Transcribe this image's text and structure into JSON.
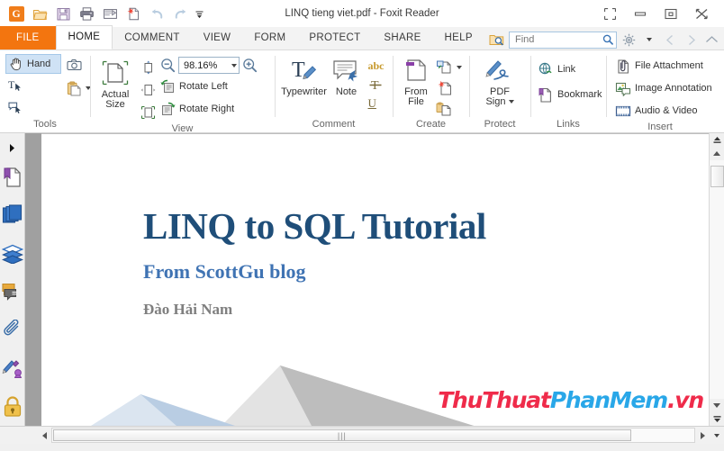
{
  "window": {
    "title": "LINQ tieng viet.pdf - Foxit Reader",
    "controls": {
      "restore_layout": "⛶",
      "minimize": "—",
      "maximize": "❐",
      "close": "✕"
    }
  },
  "quick_access": {
    "items": [
      {
        "name": "foxit-logo-icon",
        "label": "G"
      },
      {
        "name": "open-icon",
        "label": "Open"
      },
      {
        "name": "save-icon",
        "label": "Save"
      },
      {
        "name": "print-icon",
        "label": "Print"
      },
      {
        "name": "email-icon",
        "label": "Email"
      },
      {
        "name": "new-from-file-icon",
        "label": "New"
      },
      {
        "name": "undo-icon",
        "label": "Undo"
      },
      {
        "name": "redo-icon",
        "label": "Redo"
      },
      {
        "name": "qat-dropdown-icon",
        "label": "More"
      }
    ]
  },
  "tabs": [
    {
      "label": "FILE",
      "active": false,
      "file": true
    },
    {
      "label": "HOME",
      "active": true,
      "file": false
    },
    {
      "label": "COMMENT",
      "active": false,
      "file": false
    },
    {
      "label": "VIEW",
      "active": false,
      "file": false
    },
    {
      "label": "FORM",
      "active": false,
      "file": false
    },
    {
      "label": "PROTECT",
      "active": false,
      "file": false
    },
    {
      "label": "SHARE",
      "active": false,
      "file": false
    },
    {
      "label": "HELP",
      "active": false,
      "file": false
    }
  ],
  "search": {
    "placeholder": "Find",
    "value": "",
    "icon": "search-icon",
    "settings_icon": "gear-icon"
  },
  "ribbon": {
    "groups": [
      {
        "label": "Tools",
        "buttons": [
          {
            "label": "Hand",
            "icon": "hand-icon",
            "selected": true
          },
          {
            "label": "Select Text",
            "icon": "select-text-icon",
            "selected": false
          },
          {
            "label": "Select Annotation",
            "icon": "select-annotation-icon",
            "selected": false
          },
          {
            "label": "Snapshot",
            "icon": "camera-icon",
            "selected": false
          },
          {
            "label": "Clipboard",
            "icon": "clipboard-icon",
            "selected": false
          }
        ]
      },
      {
        "label": "View",
        "buttons": [
          {
            "label": "Actual Size",
            "icon": "actual-size-icon"
          },
          {
            "label": "Fit Page",
            "icon": "fit-page-icon"
          },
          {
            "label": "Fit Width",
            "icon": "fit-width-icon"
          },
          {
            "label": "Fit Visible",
            "icon": "fit-visible-icon"
          },
          {
            "label": "Zoom Out",
            "icon": "zoom-out-icon"
          },
          {
            "label": "Zoom In",
            "icon": "zoom-in-icon"
          },
          {
            "label": "Rotate Left",
            "icon": "rotate-left-icon"
          },
          {
            "label": "Rotate Right",
            "icon": "rotate-right-icon"
          }
        ],
        "zoom_value": "98.16%"
      },
      {
        "label": "Comment",
        "buttons": [
          {
            "label": "Typewriter",
            "icon": "typewriter-icon"
          },
          {
            "label": "Note",
            "icon": "note-icon"
          },
          {
            "label": "Highlight",
            "icon": "abc-highlight-icon"
          },
          {
            "label": "Strikeout",
            "icon": "strikeout-icon"
          },
          {
            "label": "Underline",
            "icon": "underline-icon"
          }
        ]
      },
      {
        "label": "Create",
        "buttons": [
          {
            "label": "From File",
            "icon": "from-file-icon"
          },
          {
            "label": "From Scanner",
            "icon": "from-scanner-icon"
          },
          {
            "label": "Blank",
            "icon": "blank-page-icon"
          },
          {
            "label": "From Clipboard",
            "icon": "from-clipboard-icon"
          }
        ]
      },
      {
        "label": "Protect",
        "buttons": [
          {
            "label": "PDF Sign",
            "icon": "pdf-sign-icon"
          }
        ]
      },
      {
        "label": "Links",
        "buttons": [
          {
            "label": "Link",
            "icon": "link-icon"
          },
          {
            "label": "Bookmark",
            "icon": "bookmark-icon"
          }
        ]
      },
      {
        "label": "Insert",
        "buttons": [
          {
            "label": "File Attachment",
            "icon": "file-attachment-icon"
          },
          {
            "label": "Image Annotation",
            "icon": "image-annotation-icon"
          },
          {
            "label": "Audio & Video",
            "icon": "audio-video-icon"
          }
        ]
      }
    ],
    "labels": {
      "hand": "Hand",
      "actual_size": "Actual Size",
      "rotate_left": "Rotate Left",
      "rotate_right": "Rotate Right",
      "typewriter": "Typewriter",
      "note": "Note",
      "from_file": "From File",
      "pdf_sign": "PDF Sign",
      "link": "Link",
      "bookmark": "Bookmark",
      "file_attachment": "File Attachment",
      "image_annotation": "Image Annotation",
      "audio_video": "Audio & Video",
      "abc": "abc",
      "underline": "U"
    }
  },
  "sidebar": {
    "items": [
      {
        "name": "sidebar-expand-toggle",
        "label": "Expand Panel"
      },
      {
        "name": "sidebar-item-bookmarks",
        "label": "Bookmarks"
      },
      {
        "name": "sidebar-item-pages",
        "label": "Page Thumbnails"
      },
      {
        "name": "sidebar-item-layers",
        "label": "Layers"
      },
      {
        "name": "sidebar-item-comments",
        "label": "Comments"
      },
      {
        "name": "sidebar-item-attachments",
        "label": "Attachments"
      },
      {
        "name": "sidebar-item-signatures",
        "label": "Digital Signatures"
      },
      {
        "name": "sidebar-item-security",
        "label": "Security"
      }
    ]
  },
  "document": {
    "title": "LINQ to SQL Tutorial",
    "subtitle": "From ScottGu blog",
    "author": "Đào Hải Nam",
    "watermark": {
      "part1": "ThuThuat",
      "part2": "PhanMem",
      "part3": ".vn"
    }
  },
  "colors": {
    "accent_orange": "#f3750f",
    "doc_title": "#1f4e79",
    "doc_subtitle": "#3f73b3",
    "doc_author": "#7f7f7f",
    "watermark_red": "#ef2b4a",
    "watermark_blue": "#29a7e8",
    "selection_blue": "#cfe2f5"
  }
}
